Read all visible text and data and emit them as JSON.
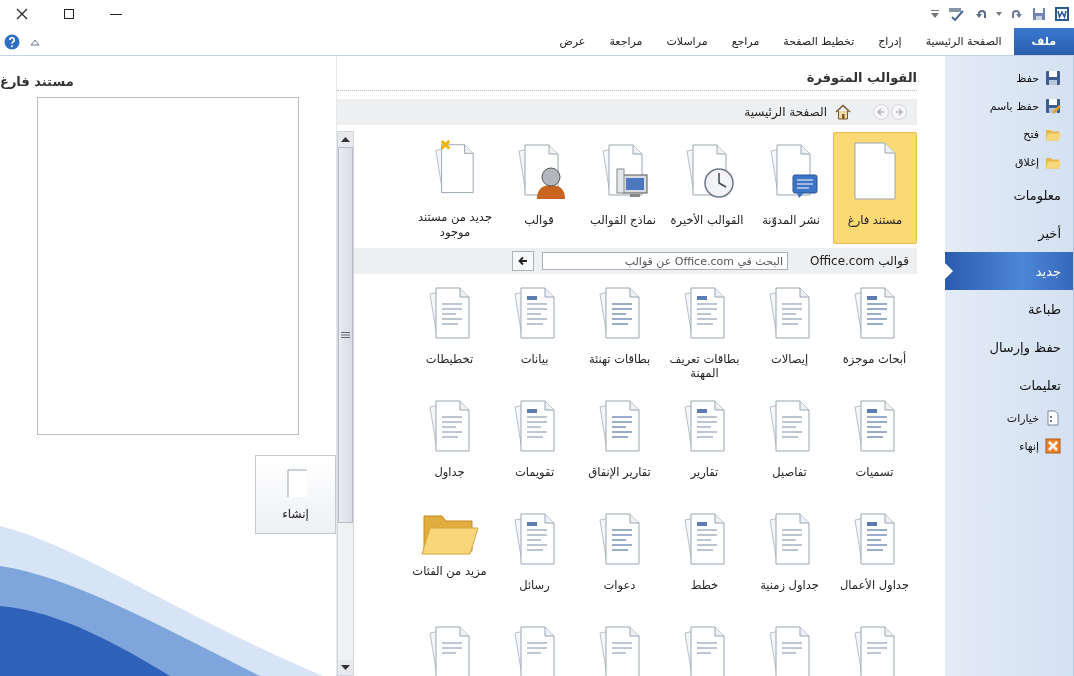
{
  "ribbon_tabs": [
    {
      "label": "ملف",
      "selected": true
    },
    {
      "label": "الصفحة الرئيسية",
      "selected": false
    },
    {
      "label": "إدراج",
      "selected": false
    },
    {
      "label": "تخطيط الصفحة",
      "selected": false
    },
    {
      "label": "مراجع",
      "selected": false
    },
    {
      "label": "مراسلات",
      "selected": false
    },
    {
      "label": "مراجعة",
      "selected": false
    },
    {
      "label": "عرض",
      "selected": false
    }
  ],
  "backstage_menu": [
    {
      "kind": "command",
      "label": "حفظ",
      "selected": false
    },
    {
      "kind": "command",
      "label": "حفظ باسم",
      "selected": false
    },
    {
      "kind": "command",
      "label": "فتح",
      "selected": false
    },
    {
      "kind": "command",
      "label": "إغلاق",
      "selected": false
    },
    {
      "kind": "section",
      "label": "معلومات",
      "selected": false
    },
    {
      "kind": "section",
      "label": "أخير",
      "selected": false
    },
    {
      "kind": "section",
      "label": "جديد",
      "selected": true
    },
    {
      "kind": "section",
      "label": "طباعة",
      "selected": false
    },
    {
      "kind": "section",
      "label": "حفظ وإرسال",
      "selected": false
    },
    {
      "kind": "section",
      "label": "تعليمات",
      "selected": false
    },
    {
      "kind": "command",
      "label": "خيارات",
      "selected": false
    },
    {
      "kind": "command",
      "label": "إنهاء",
      "selected": false
    }
  ],
  "available_templates": {
    "title": "القوالب المتوفرة",
    "location": "الصفحة الرئيسية",
    "items": [
      {
        "label": "مستند فارغ",
        "selected": true
      },
      {
        "label": "نشر المدوّنة",
        "selected": false
      },
      {
        "label": "القوالب الأخيرة",
        "selected": false
      },
      {
        "label": "نماذج القوالب",
        "selected": false
      },
      {
        "label": "قوالب",
        "selected": false
      },
      {
        "label": "جديد من مستند موجود",
        "selected": false
      }
    ]
  },
  "office_com": {
    "title": "قوالب Office.com",
    "search_placeholder": "البحث في Office.com عن قوالب",
    "categories": [
      {
        "kind": "category",
        "label": "أبحاث موجزة"
      },
      {
        "kind": "category",
        "label": "إيصالات"
      },
      {
        "kind": "category",
        "label": "بطاقات تعريف المهنة"
      },
      {
        "kind": "category",
        "label": "بطاقات تهنئة"
      },
      {
        "kind": "category",
        "label": "بيانات"
      },
      {
        "kind": "category",
        "label": "تخطيطات"
      },
      {
        "kind": "category",
        "label": "تسميات"
      },
      {
        "kind": "category",
        "label": "تفاصيل"
      },
      {
        "kind": "category",
        "label": "تقارير"
      },
      {
        "kind": "category",
        "label": "تقارير الإنفاق"
      },
      {
        "kind": "category",
        "label": "تقويمات"
      },
      {
        "kind": "category",
        "label": "جداول"
      },
      {
        "kind": "category",
        "label": "جداول الأعمال"
      },
      {
        "kind": "category",
        "label": "جداول زمنية"
      },
      {
        "kind": "category",
        "label": "خطط"
      },
      {
        "kind": "category",
        "label": "دعوات"
      },
      {
        "kind": "category",
        "label": "رسائل"
      },
      {
        "kind": "folder",
        "label": "مزيد من الفئات"
      }
    ]
  },
  "preview": {
    "title": "مستند فارغ",
    "create_button": "إنشاء"
  }
}
